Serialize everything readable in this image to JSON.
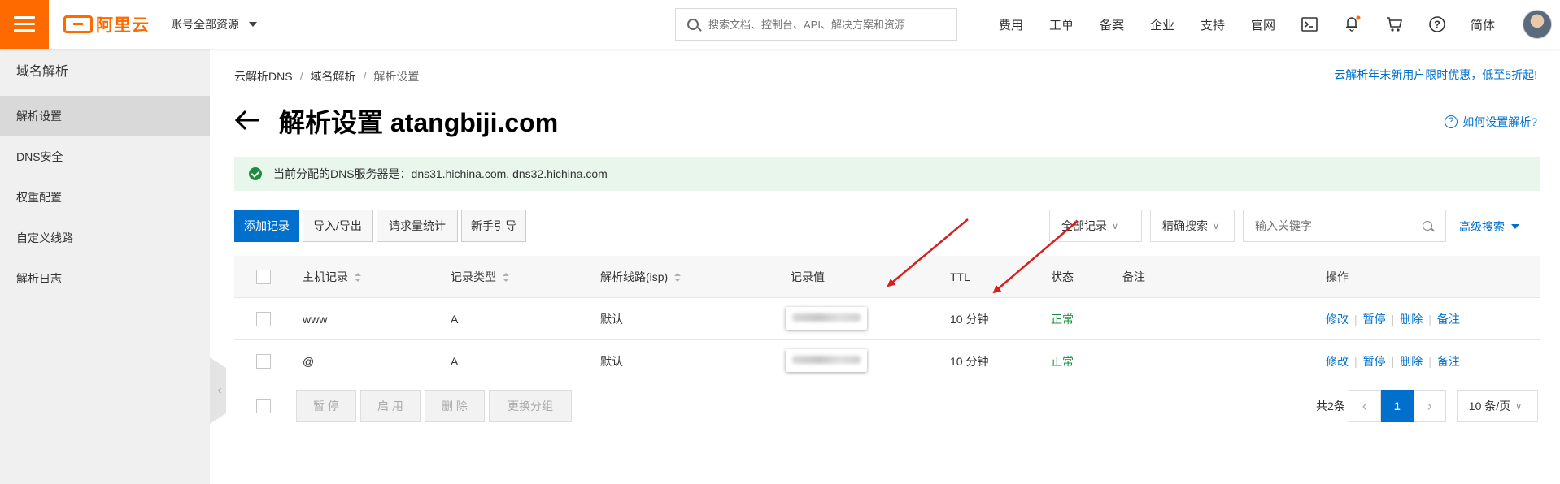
{
  "header": {
    "logo_text": "阿里云",
    "account_selector": "账号全部资源",
    "search_placeholder": "搜索文档、控制台、API、解决方案和资源",
    "nav": [
      "费用",
      "工单",
      "备案",
      "企业",
      "支持",
      "官网"
    ],
    "language": "简体",
    "icons": [
      "terminal-icon",
      "bell-icon",
      "cart-icon",
      "help-icon"
    ],
    "accent_color": "#ff6a00"
  },
  "sidebar": {
    "title": "域名解析",
    "items": [
      {
        "label": "解析设置",
        "active": true
      },
      {
        "label": "DNS安全",
        "active": false
      },
      {
        "label": "权重配置",
        "active": false
      },
      {
        "label": "自定义线路",
        "active": false
      },
      {
        "label": "解析日志",
        "active": false
      }
    ]
  },
  "breadcrumb": [
    "云解析DNS",
    "域名解析",
    "解析设置"
  ],
  "promo": "云解析年末新用户限时优惠，低至5折起!",
  "page": {
    "title": "解析设置 atangbiji.com",
    "help_link": "如何设置解析?"
  },
  "notice": "当前分配的DNS服务器是：dns31.hichina.com, dns32.hichina.com",
  "toolbar": {
    "add_record": "添加记录",
    "import_export": "导入/导出",
    "request_stats": "请求量统计",
    "guide": "新手引导",
    "filter_all": "全部记录",
    "search_mode": "精确搜索",
    "keyword_placeholder": "输入关键字",
    "advanced_search": "高级搜索"
  },
  "table": {
    "columns": [
      "主机记录",
      "记录类型",
      "解析线路(isp)",
      "记录值",
      "TTL",
      "状态",
      "备注",
      "操作"
    ],
    "rows": [
      {
        "host": "www",
        "type": "A",
        "line": "默认",
        "value": "",
        "ttl": "10 分钟",
        "status": "正常",
        "remark": ""
      },
      {
        "host": "@",
        "type": "A",
        "line": "默认",
        "value": "",
        "ttl": "10 分钟",
        "status": "正常",
        "remark": ""
      }
    ],
    "row_actions": [
      "修改",
      "暂停",
      "删除",
      "备注"
    ],
    "status_color": "#1e8e3e"
  },
  "bulk_actions": [
    "暂 停",
    "启 用",
    "删 除",
    "更换分组"
  ],
  "pagination": {
    "total": "共2条",
    "current_page": "1",
    "page_size": "10 条/页"
  },
  "link_color": "#0070cc",
  "annotation_color": "#d81e1e"
}
